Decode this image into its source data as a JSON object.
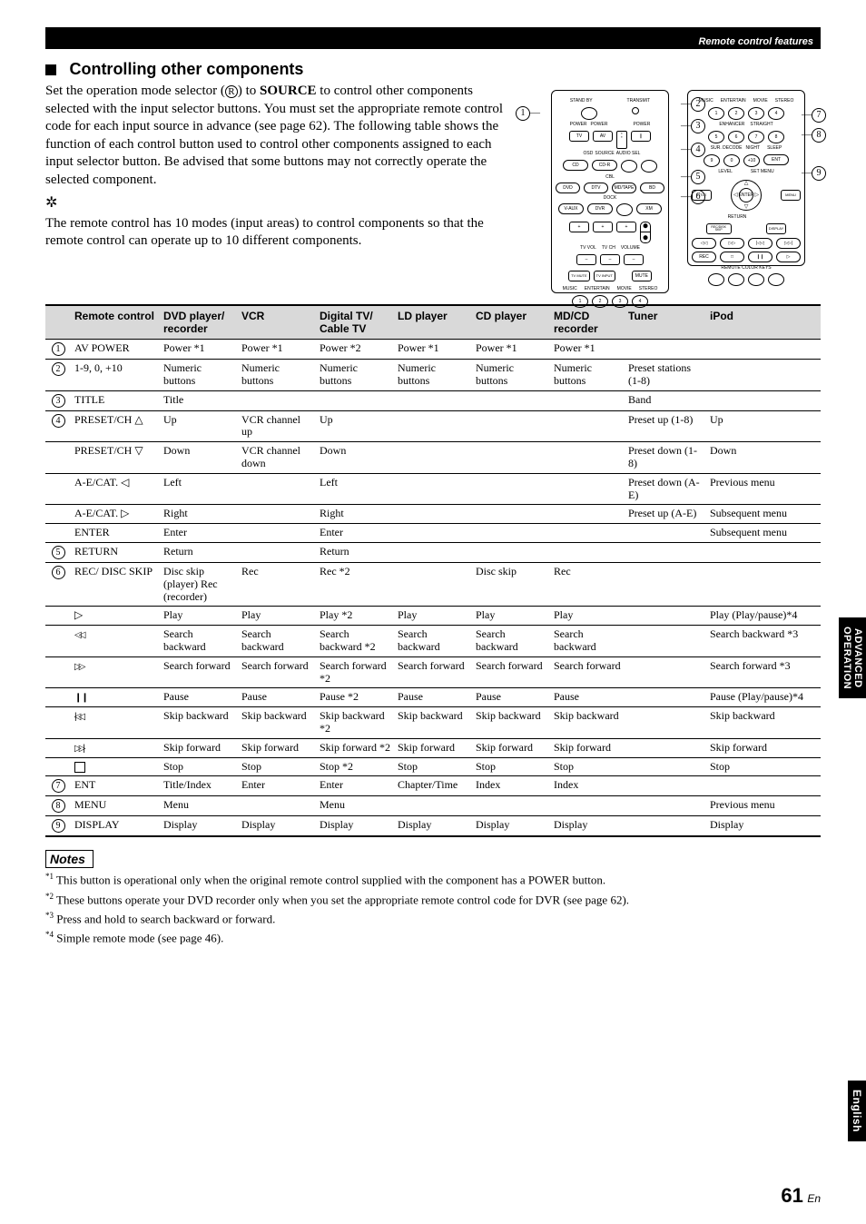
{
  "header": {
    "section": "Remote control features"
  },
  "heading": "Controlling other components",
  "intro": {
    "p1a": "Set the operation mode selector (",
    "p1b": ") to ",
    "p1c": "SOURCE",
    "p1d": " to control other components selected with the input selector buttons. You must set the appropriate remote control code for each input source in advance (see page 62). The following table shows the function of each control button used to control other components assigned to each input selector button. Be advised that some buttons may not correctly operate the selected component.",
    "tip": "The remote control has 10 modes (input areas) to control components so that the remote control can operate up to 10 different components."
  },
  "remote_labels": {
    "a": {
      "row1": [
        "STAND BY",
        "",
        "TRANSMIT"
      ],
      "row2": [
        "POWER",
        "POWER",
        "",
        "POWER"
      ],
      "row3": [
        "TV",
        "AV",
        "",
        "",
        ""
      ],
      "row4_lbls": [
        "",
        "",
        "OSD",
        "SOURCE",
        "AUDIO SEL"
      ],
      "row4": [
        "CD",
        "CD-R",
        "",
        ""
      ],
      "row5_lbl": "CBL",
      "row5": [
        "DVD",
        "DTV",
        "MD/TAPE",
        "BD"
      ],
      "row6_lbl": "DOCK",
      "row6": [
        "V-AUX",
        "DVR",
        "",
        "XM"
      ],
      "row7": [
        "+",
        "+",
        "+"
      ],
      "row7_lbl": [
        "TV VOL",
        "TV CH",
        "VOLUME"
      ],
      "row8": [
        "–",
        "–",
        "–"
      ],
      "row9": [
        "TV MUTE",
        "TV INPUT",
        "",
        "MUTE"
      ],
      "bottom_lbls": [
        "MUSIC",
        "ENTERTAIN",
        "MOVIE",
        "STEREO"
      ],
      "bottom": [
        "1",
        "2",
        "3",
        "4"
      ]
    },
    "b": {
      "row0": [
        "MUSIC",
        "ENTERTAIN",
        "MOVIE",
        "STEREO"
      ],
      "row1": [
        "1",
        "2",
        "3",
        "4"
      ],
      "row2_lbl": [
        "",
        "ENHANCER",
        "STRAIGHT",
        ""
      ],
      "row2": [
        "5",
        "6",
        "7",
        "8"
      ],
      "row3_lbl": [
        "SUR. DECODE",
        "NIGHT",
        "",
        "SLEEP"
      ],
      "row3": [
        "9",
        "0",
        "+10",
        "ENT"
      ],
      "row4_lbl": [
        "LEVEL",
        "",
        "SET MENU"
      ],
      "row4": [
        "TITLE",
        "△",
        "MENU"
      ],
      "row5": [
        "◁",
        "ENTER",
        "▷"
      ],
      "row6_lbl": [
        "RETURN",
        "",
        ""
      ],
      "row6": [
        "REC/DISK SKIP",
        "▽",
        "DISPLAY"
      ],
      "row7": [
        "◁◁",
        "▷▷",
        "|◁◁",
        "▷▷|"
      ],
      "row8": [
        "REC",
        "",
        "❙❙",
        "▷"
      ],
      "clr_lbl": "REMOTE COLOR KEYS",
      "clr": [
        "",
        "",
        "",
        ""
      ]
    }
  },
  "callouts_left": [
    "1"
  ],
  "callouts_mid": [
    "2",
    "3",
    "4",
    "5",
    "6"
  ],
  "callouts_right": [
    "7",
    "8",
    "9"
  ],
  "table": {
    "headers": [
      "",
      "Remote control",
      "DVD player/ recorder",
      "VCR",
      "Digital TV/ Cable TV",
      "LD player",
      "CD player",
      "MD/CD recorder",
      "Tuner",
      "iPod"
    ],
    "rows": [
      {
        "n": "1",
        "rc": "AV POWER",
        "cells": [
          "Power *1",
          "Power *1",
          "Power *2",
          "Power *1",
          "Power *1",
          "Power *1",
          "",
          ""
        ]
      },
      {
        "n": "2",
        "rc": "1-9, 0, +10",
        "cells": [
          "Numeric buttons",
          "Numeric buttons",
          "Numeric buttons",
          "Numeric buttons",
          "Numeric buttons",
          "Numeric buttons",
          "Preset stations (1-8)",
          ""
        ]
      },
      {
        "n": "3",
        "rc": "TITLE",
        "cells": [
          "Title",
          "",
          "",
          "",
          "",
          "",
          "Band",
          ""
        ]
      },
      {
        "n": "4",
        "rc": "PRESET/CH △",
        "cells": [
          "Up",
          "VCR channel up",
          "Up",
          "",
          "",
          "",
          "Preset up (1-8)",
          "Up"
        ]
      },
      {
        "n": "",
        "rc": "PRESET/CH ▽",
        "cells": [
          "Down",
          "VCR channel down",
          "Down",
          "",
          "",
          "",
          "Preset down (1-8)",
          "Down"
        ]
      },
      {
        "n": "",
        "rc": "A-E/CAT. ◁",
        "cells": [
          "Left",
          "",
          "Left",
          "",
          "",
          "",
          "Preset down (A-E)",
          "Previous menu"
        ]
      },
      {
        "n": "",
        "rc": "A-E/CAT. ▷",
        "cells": [
          "Right",
          "",
          "Right",
          "",
          "",
          "",
          "Preset up (A-E)",
          "Subsequent menu"
        ]
      },
      {
        "n": "",
        "rc": "ENTER",
        "cells": [
          "Enter",
          "",
          "Enter",
          "",
          "",
          "",
          "",
          "Subsequent menu"
        ]
      },
      {
        "n": "5",
        "rc": "RETURN",
        "cells": [
          "Return",
          "",
          "Return",
          "",
          "",
          "",
          "",
          ""
        ]
      },
      {
        "n": "6",
        "rc": "REC/ DISC SKIP",
        "cells": [
          "Disc skip (player) Rec (recorder)",
          "Rec",
          "Rec *2",
          "",
          "Disc skip",
          "Rec",
          "",
          ""
        ]
      },
      {
        "n": "",
        "rc": "▷",
        "icon": "tri-right",
        "cells": [
          "Play",
          "Play",
          "Play *2",
          "Play",
          "Play",
          "Play",
          "",
          "Play (Play/pause)*4"
        ]
      },
      {
        "n": "",
        "rc": "◁◁",
        "icon": "dtri-left",
        "cells": [
          "Search backward",
          "Search backward",
          "Search backward *2",
          "Search backward",
          "Search backward",
          "Search backward",
          "",
          "Search backward *3"
        ]
      },
      {
        "n": "",
        "rc": "▷▷",
        "icon": "dtri-right",
        "cells": [
          "Search forward",
          "Search forward",
          "Search forward *2",
          "Search forward",
          "Search forward",
          "Search forward",
          "",
          "Search forward *3"
        ]
      },
      {
        "n": "",
        "rc": "❙❙",
        "icon": "pause-ico",
        "cells": [
          "Pause",
          "Pause",
          "Pause *2",
          "Pause",
          "Pause",
          "Pause",
          "",
          "Pause (Play/pause)*4"
        ]
      },
      {
        "n": "",
        "rc": "|◁◁",
        "icon": "skipb",
        "cells": [
          "Skip backward",
          "Skip backward",
          "Skip backward *2",
          "Skip backward",
          "Skip backward",
          "Skip backward",
          "",
          "Skip backward"
        ]
      },
      {
        "n": "",
        "rc": "▷▷|",
        "icon": "skipf",
        "cells": [
          "Skip forward",
          "Skip forward",
          "Skip forward *2",
          "Skip forward",
          "Skip forward",
          "Skip forward",
          "",
          "Skip forward"
        ]
      },
      {
        "n": "",
        "rc": "□",
        "icon": "stop-ico",
        "cells": [
          "Stop",
          "Stop",
          "Stop *2",
          "Stop",
          "Stop",
          "Stop",
          "",
          "Stop"
        ]
      },
      {
        "n": "7",
        "rc": "ENT",
        "cells": [
          "Title/Index",
          "Enter",
          "Enter",
          "Chapter/Time",
          "Index",
          "Index",
          "",
          ""
        ]
      },
      {
        "n": "8",
        "rc": "MENU",
        "cells": [
          "Menu",
          "",
          "Menu",
          "",
          "",
          "",
          "",
          "Previous menu"
        ]
      },
      {
        "n": "9",
        "rc": "DISPLAY",
        "cells": [
          "Display",
          "Display",
          "Display",
          "Display",
          "Display",
          "Display",
          "",
          "Display"
        ]
      }
    ]
  },
  "notes": {
    "title": "Notes",
    "items": [
      {
        "n": "*1",
        "t": "This button is operational only when the original remote control supplied with the component has a POWER button."
      },
      {
        "n": "*2",
        "t": "These buttons operate your DVD recorder only when you set the appropriate remote control code for DVR (see page 62)."
      },
      {
        "n": "*3",
        "t": "Press and hold to search backward or forward."
      },
      {
        "n": "*4",
        "t": "Simple remote mode (see page 46)."
      }
    ]
  },
  "side": {
    "op1": "ADVANCED",
    "op2": "OPERATION",
    "lang": "English"
  },
  "pagenum": {
    "big": "61",
    "sm": "En"
  }
}
